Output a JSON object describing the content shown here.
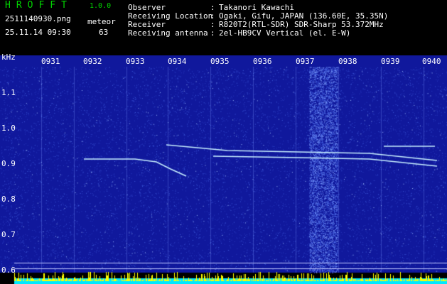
{
  "app": {
    "title": "HROFFT",
    "version": "1.0.0"
  },
  "file": {
    "name": "2511140930.png",
    "datetime": "25.11.14 09:30"
  },
  "detection": {
    "label": "meteor",
    "count": "63"
  },
  "info": [
    {
      "key": "Observer",
      "value": "Takanori Kawachi"
    },
    {
      "key": "Receiving Location",
      "value": "Ogaki, Gifu, JAPAN (136.60E, 35.35N)"
    },
    {
      "key": "Receiver",
      "value": "R820T2(RTL-SDR) SDR-Sharp 53.372MHz"
    },
    {
      "key": "Receiving antenna",
      "value": "2el-HB9CV Vertical (el. E-W)"
    }
  ],
  "spectrogram": {
    "y_unit": "kHz",
    "y_ticks": [
      "1.1",
      "1.0",
      "0.9",
      "0.8",
      "0.7",
      "0.6"
    ],
    "x_ticks": [
      "0931",
      "0932",
      "0933",
      "0934",
      "0935",
      "0936",
      "0937",
      "0938",
      "0939",
      "0940"
    ],
    "colors": {
      "background": "#10189c",
      "noise": "#3a5ad8",
      "echo": "#c8f0ff",
      "level": "#00e8ff",
      "peak": "#ffff00"
    }
  }
}
